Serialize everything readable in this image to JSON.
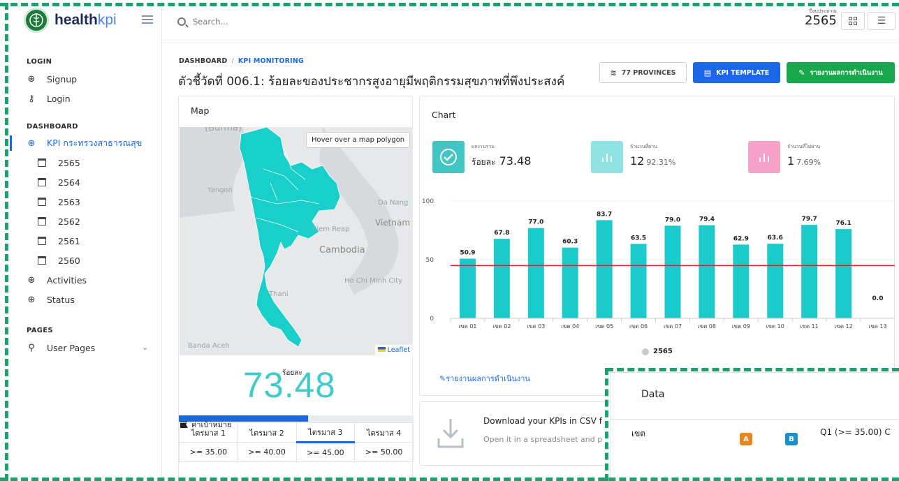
{
  "brand": {
    "bold": "health",
    "light": "kpi"
  },
  "search": {
    "placeholder": "Search..."
  },
  "topbar": {
    "year_caption": "ปีงบประมาณ",
    "year": "2565"
  },
  "sidebar": {
    "sections": {
      "login": "LOGIN",
      "dashboard": "DASHBOARD",
      "pages": "PAGES"
    },
    "login_items": [
      {
        "label": "Signup",
        "icon": "globe-icon"
      },
      {
        "label": "Login",
        "icon": "key-icon"
      }
    ],
    "dashboard_items": [
      {
        "label": "KPI กระทรวงสาธารณสุข",
        "icon": "globe-icon",
        "active": true
      },
      {
        "label": "2565",
        "icon": "calendar-icon"
      },
      {
        "label": "2564",
        "icon": "calendar-icon"
      },
      {
        "label": "2563",
        "icon": "calendar-icon"
      },
      {
        "label": "2562",
        "icon": "calendar-icon"
      },
      {
        "label": "2561",
        "icon": "calendar-icon"
      },
      {
        "label": "2560",
        "icon": "calendar-icon"
      },
      {
        "label": "Activities",
        "icon": "globe-icon"
      },
      {
        "label": "Status",
        "icon": "globe-icon"
      }
    ],
    "pages_items": [
      {
        "label": "User Pages",
        "icon": "user-icon"
      }
    ]
  },
  "breadcrumb": {
    "root": "DASHBOARD",
    "sep": "/",
    "current": "KPI MONITORING"
  },
  "page_title": "ตัวชี้วัดที่ 006.1: ร้อยละของประชากรสูงอายุมีพฤติกรรมสุขภาพที่พึงประสงค์",
  "buttons": {
    "provinces": "77 PROVINCES",
    "kpi_template": "KPI TEMPLATE",
    "report": "รายงานผลการดำเนินงาน"
  },
  "map_card": {
    "title": "Map",
    "tooltip": "Hover over a map polygon",
    "attribution": "Leaflet",
    "labels": [
      "(Burma)",
      "Yangon",
      "Da Nang",
      "Vietnam",
      "Siem Reap",
      "Cambodia",
      "Ho Chi Minh City",
      "Thani",
      "Banda Aceh"
    ],
    "big_caption": "ร้อยละ",
    "big_value": "73.48",
    "target_label": "ค่าเป้าหมาย",
    "progress_pct": 55,
    "quarters": [
      "ไตรมาส 1",
      "ไตรมาส 2",
      "ไตรมาส 3",
      "ไตรมาส 4"
    ],
    "quarter_targets": [
      ">= 35.00",
      ">= 40.00",
      ">= 45.00",
      ">= 50.00"
    ],
    "active_quarter": 2
  },
  "chart_card": {
    "title": "Chart",
    "stats": [
      {
        "caption": "ผลงานรวม",
        "prefix": "ร้อยละ",
        "value": "73.48",
        "pct": "",
        "color": "#41c6c3",
        "icon": "check-icon"
      },
      {
        "caption": "จำนวนที่ผ่าน",
        "prefix": "",
        "value": "12",
        "pct": "92.31%",
        "color": "#8fe3e3",
        "icon": "bar-chart-icon"
      },
      {
        "caption": "จำนวนที่ไม่ผ่าน",
        "prefix": "",
        "value": "1",
        "pct": "7.69%",
        "color": "#f7a1c9",
        "icon": "bar-chart-icon"
      }
    ],
    "legend": "2565",
    "report_link": "รายงานผลการดำเนินงาน"
  },
  "chart_data": {
    "type": "bar",
    "categories": [
      "เขต 01",
      "เขต 02",
      "เขต 03",
      "เขต 04",
      "เขต 05",
      "เขต 06",
      "เขต 07",
      "เขต 08",
      "เขต 09",
      "เขต 10",
      "เขต 11",
      "เขต 12",
      "เขต 13"
    ],
    "series": [
      {
        "name": "2565",
        "values": [
          50.9,
          67.8,
          77.0,
          60.3,
          83.7,
          63.5,
          79.0,
          79.4,
          62.9,
          63.6,
          79.7,
          76.1,
          0.0
        ]
      }
    ],
    "value_labels": [
      "50.9",
      "67.8",
      "77.0",
      "60.3",
      "83.7",
      "63.5",
      "79.0",
      "79.4",
      "62.9",
      "63.6",
      "79.7",
      "76.1",
      "0.0"
    ],
    "target_line": 45,
    "yticks": [
      0,
      50,
      100
    ],
    "ylim": [
      0,
      100
    ],
    "colors": {
      "bar": "#1bcbcb",
      "target": "#e02424"
    }
  },
  "download_card": {
    "title": "Download your KPIs in CSV f",
    "subtitle": "Open it in a spreadsheet and p"
  },
  "data_card": {
    "title": "Data",
    "col_region": "เขต",
    "badge_a": "A",
    "badge_b": "B",
    "col_q1": "Q1 (>= 35.00)  C"
  }
}
